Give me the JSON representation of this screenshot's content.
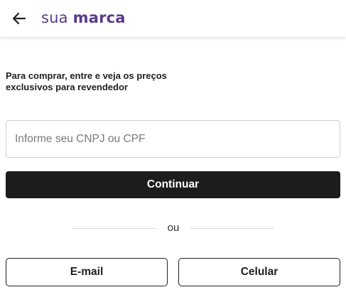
{
  "header": {
    "back_icon": "arrow-left-icon",
    "brand_light": "sua",
    "brand_bold": "marca",
    "brand_color": "#5b3a8c"
  },
  "login": {
    "intro_text": "Para comprar, entre e veja os preços exclusivos para revendedor",
    "document_input": {
      "value": "",
      "placeholder": "Informe seu CNPJ ou CPF"
    },
    "continue_label": "Continuar",
    "continue_color": "#1c1c1c",
    "divider_text": "ou",
    "email_label": "E-mail",
    "phone_label": "Celular"
  }
}
